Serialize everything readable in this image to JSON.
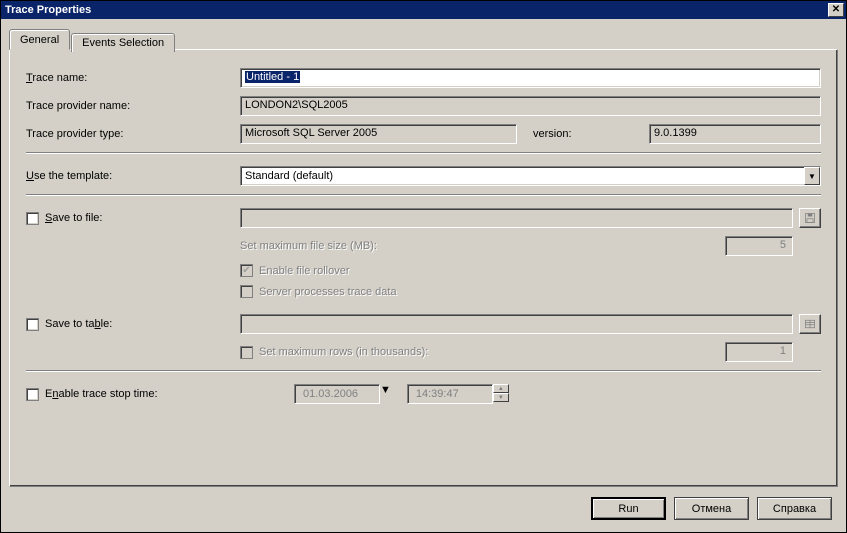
{
  "window": {
    "title": "Trace Properties"
  },
  "tabs": {
    "general": "General",
    "events": "Events Selection"
  },
  "labels": {
    "trace_name": "Trace name:",
    "provider_name": "Trace provider name:",
    "provider_type": "Trace provider type:",
    "version": "version:",
    "use_template": "Use the template:",
    "save_to_file": "Save to file:",
    "max_file_size": "Set maximum file size (MB):",
    "enable_rollover": "Enable file rollover",
    "server_processes": "Server processes trace data",
    "save_to_table": "Save to table:",
    "max_rows": "Set maximum rows (in thousands):",
    "enable_stop_time": "Enable trace stop time:"
  },
  "values": {
    "trace_name": "Untitled - 1",
    "provider_name": "LONDON2\\SQL2005",
    "provider_type": "Microsoft SQL Server 2005",
    "version": "9.0.1399",
    "template": "Standard (default)",
    "max_file_size": "5",
    "max_rows": "1",
    "stop_date": "01.03.2006",
    "stop_time": "14:39:47"
  },
  "checkboxes": {
    "save_to_file": false,
    "enable_rollover": true,
    "server_processes": false,
    "save_to_table": false,
    "max_rows": false,
    "enable_stop_time": false
  },
  "buttons": {
    "run": "Run",
    "cancel": "Отмена",
    "help": "Справка"
  }
}
